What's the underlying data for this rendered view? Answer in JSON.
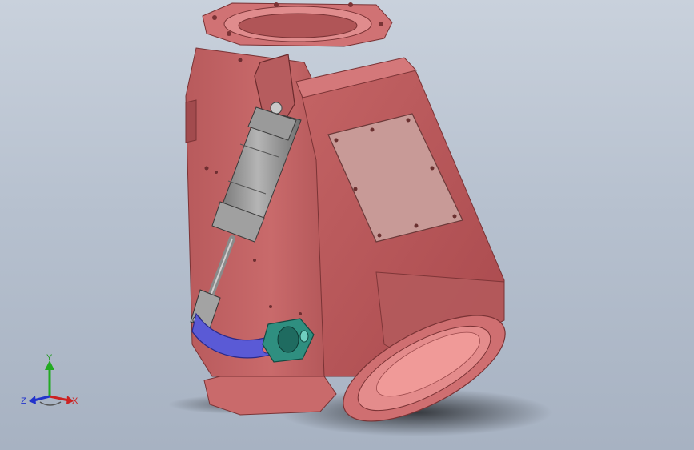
{
  "viewport": {
    "background_top": "#c9d1dc",
    "background_bottom": "#a7b2c2"
  },
  "model": {
    "body_color": "#c86a6a",
    "body_shadow": "#a94f52",
    "cover_plate_color": "#c89a97",
    "cylinder_color": "#8c8c8c",
    "lever_color": "#5a5ad6",
    "bearing_color": "#2f8f80"
  },
  "triad": {
    "x_label": "X",
    "y_label": "Y",
    "z_label": "Z",
    "x_color": "#cc2222",
    "y_color": "#22aa22",
    "z_color": "#2233cc"
  }
}
